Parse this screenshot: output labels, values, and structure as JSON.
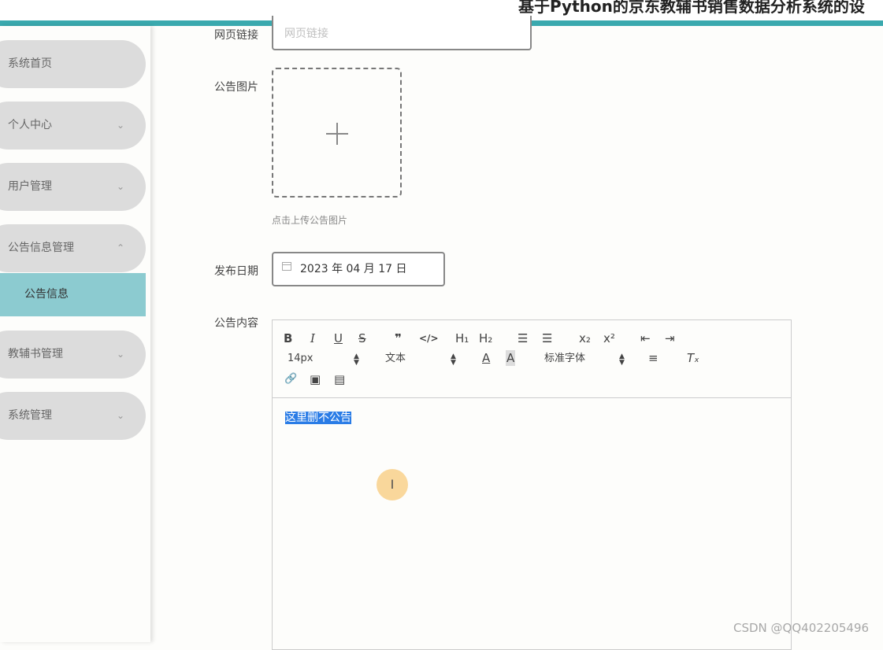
{
  "app": {
    "title": "基于Python的京东教辅书销售数据分析系统的设"
  },
  "sidebar": {
    "items": [
      {
        "label": "系统首页",
        "chevron": ""
      },
      {
        "label": "个人中心",
        "chevron": "⌄"
      },
      {
        "label": "用户管理",
        "chevron": "⌄"
      },
      {
        "label": "公告信息管理",
        "chevron": "⌃"
      },
      {
        "label": "教辅书管理",
        "chevron": "⌄"
      },
      {
        "label": "系统管理",
        "chevron": "⌄"
      }
    ],
    "subitem": {
      "label": "公告信息"
    }
  },
  "form": {
    "link": {
      "label": "网页链接",
      "placeholder": "网页链接"
    },
    "image": {
      "label": "公告图片",
      "hint": "点击上传公告图片",
      "plus_icon": "plus-icon"
    },
    "date": {
      "label": "发布日期",
      "value": "2023 年 04 月 17 日",
      "icon": "calendar-icon"
    },
    "content": {
      "label": "公告内容",
      "text": "这里删不公告"
    }
  },
  "editor": {
    "toolbar": {
      "bold": "B",
      "italic": "I",
      "underline": "U",
      "strike": "S",
      "quote": "❞",
      "code": "</>",
      "h1": "H₁",
      "h2": "H₂",
      "ordered_list": "☰",
      "bullet_list": "☰",
      "subscript": "x₂",
      "superscript": "x²",
      "outdent": "⇤",
      "indent": "⇥",
      "font_size": "14px",
      "text_type": "文本",
      "font_family": "标准字体",
      "font_color": "A",
      "background": "A",
      "align": "≡",
      "clear_format": "Tₓ",
      "link": "🔗",
      "image": "▣",
      "video": "▤"
    }
  },
  "cursor": {
    "glyph": "I"
  },
  "watermark": "CSDN @QQ402205496",
  "colors": {
    "accent": "#3aa9ae",
    "submenu_active": "#8ccbd0",
    "menu_bg": "#dcdcdc",
    "selection": "#2a7ce6"
  }
}
